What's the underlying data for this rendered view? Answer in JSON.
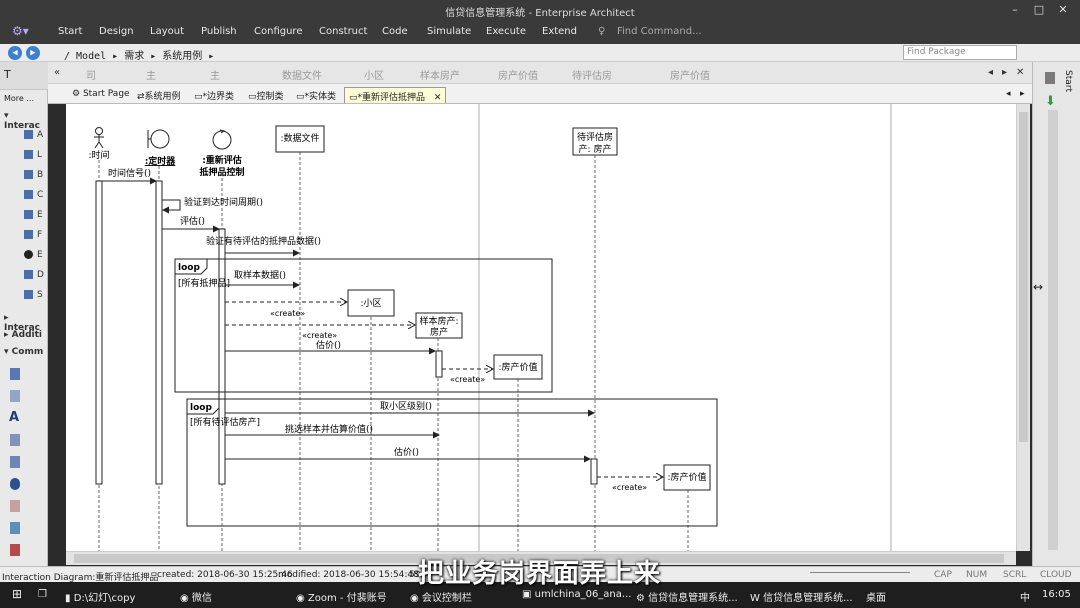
{
  "window": {
    "title": "信贷信息管理系统 - Enterprise Architect"
  },
  "menu": {
    "items": [
      "Start",
      "Design",
      "Layout",
      "Publish",
      "Configure",
      "Construct",
      "Code",
      "Simulate",
      "Execute",
      "Extend"
    ],
    "find_command": "Find Command..."
  },
  "path": {
    "root": "/",
    "crumbs": "/  Model  ▸ 需求  ▸ 系统用例  ▸"
  },
  "find_package": {
    "placeholder": "Find Package"
  },
  "left_panel": {
    "more": "More ...",
    "group1": "Interac",
    "group2": "Interac",
    "group3": "Additi",
    "group4": "Comm",
    "tools": [
      "A",
      "L",
      "B",
      "C",
      "E",
      "F",
      "E",
      "D",
      "S"
    ]
  },
  "top_tabs": [
    "司",
    "主",
    "主",
    "数据文件",
    "小区",
    "样本房产",
    "房产价值",
    "待评估房",
    "房产价值"
  ],
  "doc_tabs": {
    "start": "Start Page",
    "t1": "系统用例",
    "t2": "*边界类",
    "t3": "控制类",
    "t4": "*实体类",
    "t5": "*重新评估抵押品"
  },
  "diagram": {
    "lifelines": {
      "timer_actor": ":时间",
      "scheduler": ":定时器",
      "control_l1": ":重新评估",
      "control_l2": "抵押品控制",
      "datafile": ":数据文件",
      "district": ":小区",
      "sample_l1": "样本房产:",
      "sample_l2": "房产",
      "pending_l1": "待评估房",
      "pending_l2": "产: 房产",
      "value1": ":房产价值",
      "value2": ":房产价值"
    },
    "messages": {
      "m1": "时间信号()",
      "m2": "验证到达时间周期()",
      "m3": "评估()",
      "m4": "验证有待评估的抵押品数据()",
      "m5": "取样本数据()",
      "m6": "«create»",
      "m7": "«create»",
      "m8": "估价()",
      "m9": "«create»",
      "m10": "取小区级别()",
      "m11": "挑选样本并估算价值()",
      "m12": "估价()",
      "m13": "«create»"
    },
    "loops": {
      "l1_tag": "loop",
      "l1_guard": "[所有抵押品]",
      "l2_tag": "loop",
      "l2_guard": "[所有待评估房产]"
    }
  },
  "status": {
    "diagram": "Interaction Diagram:重新评估抵押品",
    "created": "created: 2018-06-30 15:25:46",
    "modified": "modified: 2018-06-30 15:54:48",
    "zoom": "59",
    "caps": "CAP",
    "num": "NUM",
    "scrl": "SCRL",
    "cloud": "CLOUD"
  },
  "taskbar": {
    "items": [
      "D:\\幻灯\\copy",
      "微信",
      "Zoom - 付裴账号",
      "会议控制栏",
      "umlchina_06_ana...",
      "信贷信息管理系统...",
      "信贷信息管理系统..."
    ],
    "desktop": "桌面",
    "ime": "中",
    "time": "16:05"
  },
  "right_panel": {
    "label": "Start"
  },
  "subtitle": "把业务岗界面弄上来"
}
